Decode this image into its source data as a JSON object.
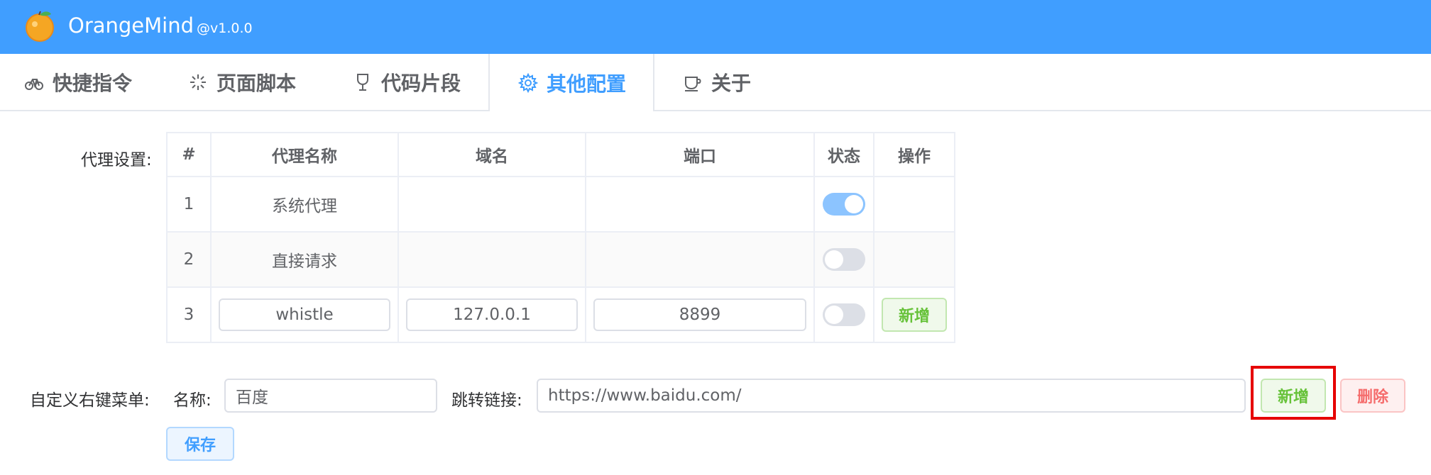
{
  "header": {
    "app_name": "OrangeMind",
    "version": "@v1.0.0",
    "bg_color": "#409eff"
  },
  "tabs": [
    {
      "label": "快捷指令",
      "icon": "bicycle-icon",
      "active": false
    },
    {
      "label": "页面脚本",
      "icon": "sparkle-icon",
      "active": false
    },
    {
      "label": "代码片段",
      "icon": "goblet-icon",
      "active": false
    },
    {
      "label": "其他配置",
      "icon": "gear-icon",
      "active": true
    },
    {
      "label": "关于",
      "icon": "coffee-cup-icon",
      "active": false
    }
  ],
  "proxy": {
    "label": "代理设置:",
    "columns": [
      "#",
      "代理名称",
      "域名",
      "端口",
      "状态",
      "操作"
    ],
    "rows": [
      {
        "index": "1",
        "name": "系统代理",
        "domain": "",
        "port": "",
        "enabled": true
      },
      {
        "index": "2",
        "name": "直接请求",
        "domain": "",
        "port": "",
        "enabled": false
      },
      {
        "index": "3",
        "name": "whistle",
        "domain": "127.0.0.1",
        "port": "8899",
        "enabled": false,
        "action": "新增"
      }
    ]
  },
  "context_menu": {
    "label": "自定义右键菜单:",
    "name_label": "名称:",
    "name_value": "百度",
    "link_label": "跳转链接:",
    "link_value": "https://www.baidu.com/",
    "add_label": "新增",
    "delete_label": "删除"
  },
  "save_label": "保存",
  "colors": {
    "accent": "#409eff",
    "success": "#67c23a",
    "danger": "#f56c6c",
    "highlight": "#e60000"
  }
}
